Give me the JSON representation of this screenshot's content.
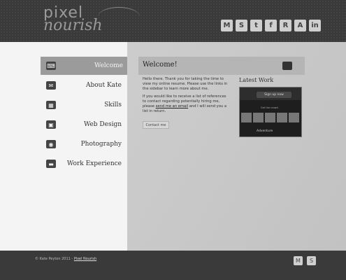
{
  "header": {
    "logo_line1": "pixel",
    "logo_line2": "nourish",
    "social": [
      {
        "icon": "gmail-icon",
        "glyph": "M"
      },
      {
        "icon": "skype-icon",
        "glyph": "S"
      },
      {
        "icon": "twitter-icon",
        "glyph": "t"
      },
      {
        "icon": "facebook-icon",
        "glyph": "f"
      },
      {
        "icon": "rss-icon",
        "glyph": "R"
      },
      {
        "icon": "deviantart-icon",
        "glyph": "A"
      },
      {
        "icon": "linkedin-icon",
        "glyph": "in"
      }
    ]
  },
  "sidebar": {
    "items": [
      {
        "label": "Welcome",
        "icon": "keyboard-icon",
        "active": true
      },
      {
        "label": "About Kate",
        "icon": "chat-icon",
        "active": false
      },
      {
        "label": "Skills",
        "icon": "calculator-icon",
        "active": false
      },
      {
        "label": "Web Design",
        "icon": "presentation-icon",
        "active": false
      },
      {
        "label": "Photography",
        "icon": "camera-icon",
        "active": false
      },
      {
        "label": "Work Experience",
        "icon": "briefcase-icon",
        "active": false
      }
    ]
  },
  "main": {
    "title": "Welcome!",
    "paragraph1": "Hello there. Thank you for taking the time to view my online resume. Please use the links in the sidebar to learn more about me.",
    "paragraph2_before": "If you would like to receive a list of references to contact regarding potentially hiring me, please ",
    "paragraph2_link": "send me an email",
    "paragraph2_after": " and I will send you a list in return.",
    "contact_button": "Contact me",
    "latest_work_title": "Latest Work",
    "latest_signup": "Sign up now",
    "latest_mini": "Get the crowd",
    "latest_caption": "Adventure"
  },
  "footer": {
    "copyright": "© Kate Peyton 2011 - ",
    "link": "Pixel Nourish",
    "icons": [
      {
        "icon": "gmail-icon",
        "glyph": "M"
      },
      {
        "icon": "skype-icon",
        "glyph": "S"
      }
    ]
  }
}
